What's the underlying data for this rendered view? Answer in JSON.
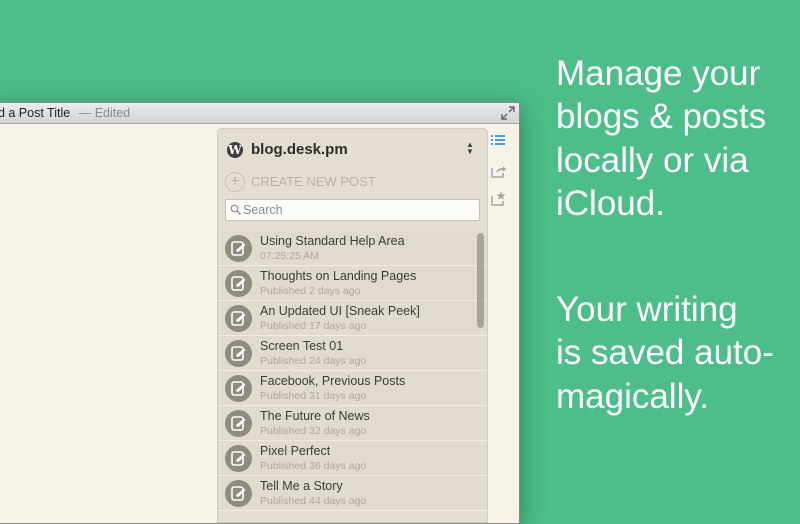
{
  "window": {
    "title": "dd a Post Title",
    "title_separator": "—",
    "status": "Edited"
  },
  "sidebar": {
    "blog_name": "blog.desk.pm",
    "create_label": "CREATE NEW POST",
    "search": {
      "placeholder": "Search",
      "value": ""
    },
    "posts": [
      {
        "title": "Using Standard Help Area",
        "meta": "07:25:25 AM"
      },
      {
        "title": "Thoughts on Landing Pages",
        "meta": "Published 2 days ago"
      },
      {
        "title": "An Updated UI [Sneak Peek]",
        "meta": "Published 17 days ago"
      },
      {
        "title": "Screen Test 01",
        "meta": "Published 24 days ago"
      },
      {
        "title": "Facebook, Previous Posts",
        "meta": "Published 31 days ago"
      },
      {
        "title": "The Future of News",
        "meta": "Published 32 days ago"
      },
      {
        "title": "Pixel Perfect",
        "meta": "Published 36 days ago"
      },
      {
        "title": "Tell Me a Story",
        "meta": "Published 44 days ago"
      }
    ]
  },
  "toolbar_icons": [
    "list-icon",
    "share-icon",
    "share-star-icon"
  ],
  "marketing": {
    "block1": [
      "Manage your",
      "blogs & posts",
      "locally or via",
      "iCloud."
    ],
    "block2": [
      "Your writing",
      "is saved auto-",
      "magically."
    ]
  },
  "colors": {
    "background": "#4dbe89",
    "editor": "#f8f3e9",
    "panel": "#e3ded1",
    "accent_blue": "#4a9de0"
  }
}
